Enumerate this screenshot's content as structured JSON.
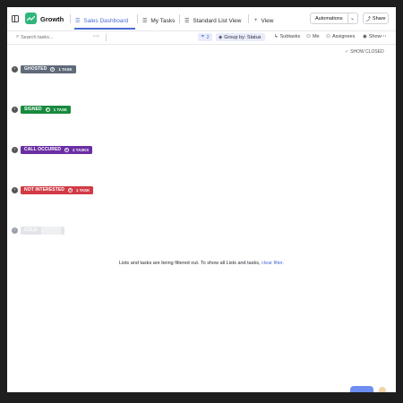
{
  "header": {
    "space_name": "Growth",
    "tabs": [
      {
        "label": "Sales Dashboard",
        "icon": "list-icon",
        "active": true
      },
      {
        "label": "My Tasks",
        "icon": "list-icon",
        "active": false
      },
      {
        "label": "Standard List View",
        "icon": "list-icon",
        "active": false
      }
    ],
    "add_view_label": "View",
    "automations_label": "Automations",
    "share_label": "Share"
  },
  "toolbar": {
    "search_placeholder": "Search tasks...",
    "more": "···",
    "filter_count": "2",
    "group_by_label": "Group by: Status",
    "subtasks_label": "Subtasks",
    "me_label": "Me",
    "assignees_label": "Assignees",
    "show_label": "Show",
    "more_right": "···"
  },
  "show_closed_label": "SHOW CLOSED",
  "groups": [
    {
      "status": "GHOSTED",
      "count_label": "1 TASK",
      "color": "#5f6b7a"
    },
    {
      "status": "SIGNED",
      "count_label": "1 TASK",
      "color": "#178a3e"
    },
    {
      "status": "CALL OCCURED",
      "count_label": "2 TASKS",
      "color": "#6b2fa3"
    },
    {
      "status": "NOT INTERESTED",
      "count_label": "1 TASK",
      "color": "#d23b45"
    },
    {
      "status": "COLD",
      "count_label": "",
      "color": "#d3d6db"
    }
  ],
  "empty_message": {
    "text": "Lists and tasks are being filtered out. To show all Lists and tasks, ",
    "link": "clear filter."
  },
  "colors": {
    "accent": "#4a6cd4",
    "space_logo": "#2fb67a"
  }
}
